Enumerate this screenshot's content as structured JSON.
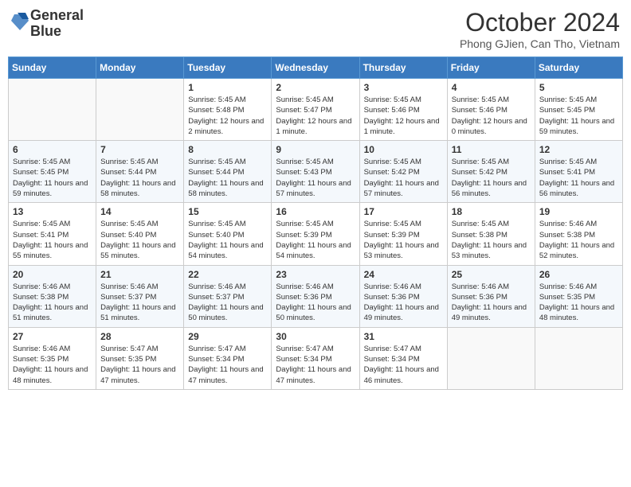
{
  "header": {
    "logo_line1": "General",
    "logo_line2": "Blue",
    "month": "October 2024",
    "location": "Phong GJien, Can Tho, Vietnam"
  },
  "weekdays": [
    "Sunday",
    "Monday",
    "Tuesday",
    "Wednesday",
    "Thursday",
    "Friday",
    "Saturday"
  ],
  "weeks": [
    [
      {
        "day": "",
        "info": ""
      },
      {
        "day": "",
        "info": ""
      },
      {
        "day": "1",
        "info": "Sunrise: 5:45 AM\nSunset: 5:48 PM\nDaylight: 12 hours and 2 minutes."
      },
      {
        "day": "2",
        "info": "Sunrise: 5:45 AM\nSunset: 5:47 PM\nDaylight: 12 hours and 1 minute."
      },
      {
        "day": "3",
        "info": "Sunrise: 5:45 AM\nSunset: 5:46 PM\nDaylight: 12 hours and 1 minute."
      },
      {
        "day": "4",
        "info": "Sunrise: 5:45 AM\nSunset: 5:46 PM\nDaylight: 12 hours and 0 minutes."
      },
      {
        "day": "5",
        "info": "Sunrise: 5:45 AM\nSunset: 5:45 PM\nDaylight: 11 hours and 59 minutes."
      }
    ],
    [
      {
        "day": "6",
        "info": "Sunrise: 5:45 AM\nSunset: 5:45 PM\nDaylight: 11 hours and 59 minutes."
      },
      {
        "day": "7",
        "info": "Sunrise: 5:45 AM\nSunset: 5:44 PM\nDaylight: 11 hours and 58 minutes."
      },
      {
        "day": "8",
        "info": "Sunrise: 5:45 AM\nSunset: 5:44 PM\nDaylight: 11 hours and 58 minutes."
      },
      {
        "day": "9",
        "info": "Sunrise: 5:45 AM\nSunset: 5:43 PM\nDaylight: 11 hours and 57 minutes."
      },
      {
        "day": "10",
        "info": "Sunrise: 5:45 AM\nSunset: 5:42 PM\nDaylight: 11 hours and 57 minutes."
      },
      {
        "day": "11",
        "info": "Sunrise: 5:45 AM\nSunset: 5:42 PM\nDaylight: 11 hours and 56 minutes."
      },
      {
        "day": "12",
        "info": "Sunrise: 5:45 AM\nSunset: 5:41 PM\nDaylight: 11 hours and 56 minutes."
      }
    ],
    [
      {
        "day": "13",
        "info": "Sunrise: 5:45 AM\nSunset: 5:41 PM\nDaylight: 11 hours and 55 minutes."
      },
      {
        "day": "14",
        "info": "Sunrise: 5:45 AM\nSunset: 5:40 PM\nDaylight: 11 hours and 55 minutes."
      },
      {
        "day": "15",
        "info": "Sunrise: 5:45 AM\nSunset: 5:40 PM\nDaylight: 11 hours and 54 minutes."
      },
      {
        "day": "16",
        "info": "Sunrise: 5:45 AM\nSunset: 5:39 PM\nDaylight: 11 hours and 54 minutes."
      },
      {
        "day": "17",
        "info": "Sunrise: 5:45 AM\nSunset: 5:39 PM\nDaylight: 11 hours and 53 minutes."
      },
      {
        "day": "18",
        "info": "Sunrise: 5:45 AM\nSunset: 5:38 PM\nDaylight: 11 hours and 53 minutes."
      },
      {
        "day": "19",
        "info": "Sunrise: 5:46 AM\nSunset: 5:38 PM\nDaylight: 11 hours and 52 minutes."
      }
    ],
    [
      {
        "day": "20",
        "info": "Sunrise: 5:46 AM\nSunset: 5:38 PM\nDaylight: 11 hours and 51 minutes."
      },
      {
        "day": "21",
        "info": "Sunrise: 5:46 AM\nSunset: 5:37 PM\nDaylight: 11 hours and 51 minutes."
      },
      {
        "day": "22",
        "info": "Sunrise: 5:46 AM\nSunset: 5:37 PM\nDaylight: 11 hours and 50 minutes."
      },
      {
        "day": "23",
        "info": "Sunrise: 5:46 AM\nSunset: 5:36 PM\nDaylight: 11 hours and 50 minutes."
      },
      {
        "day": "24",
        "info": "Sunrise: 5:46 AM\nSunset: 5:36 PM\nDaylight: 11 hours and 49 minutes."
      },
      {
        "day": "25",
        "info": "Sunrise: 5:46 AM\nSunset: 5:36 PM\nDaylight: 11 hours and 49 minutes."
      },
      {
        "day": "26",
        "info": "Sunrise: 5:46 AM\nSunset: 5:35 PM\nDaylight: 11 hours and 48 minutes."
      }
    ],
    [
      {
        "day": "27",
        "info": "Sunrise: 5:46 AM\nSunset: 5:35 PM\nDaylight: 11 hours and 48 minutes."
      },
      {
        "day": "28",
        "info": "Sunrise: 5:47 AM\nSunset: 5:35 PM\nDaylight: 11 hours and 47 minutes."
      },
      {
        "day": "29",
        "info": "Sunrise: 5:47 AM\nSunset: 5:34 PM\nDaylight: 11 hours and 47 minutes."
      },
      {
        "day": "30",
        "info": "Sunrise: 5:47 AM\nSunset: 5:34 PM\nDaylight: 11 hours and 47 minutes."
      },
      {
        "day": "31",
        "info": "Sunrise: 5:47 AM\nSunset: 5:34 PM\nDaylight: 11 hours and 46 minutes."
      },
      {
        "day": "",
        "info": ""
      },
      {
        "day": "",
        "info": ""
      }
    ]
  ]
}
